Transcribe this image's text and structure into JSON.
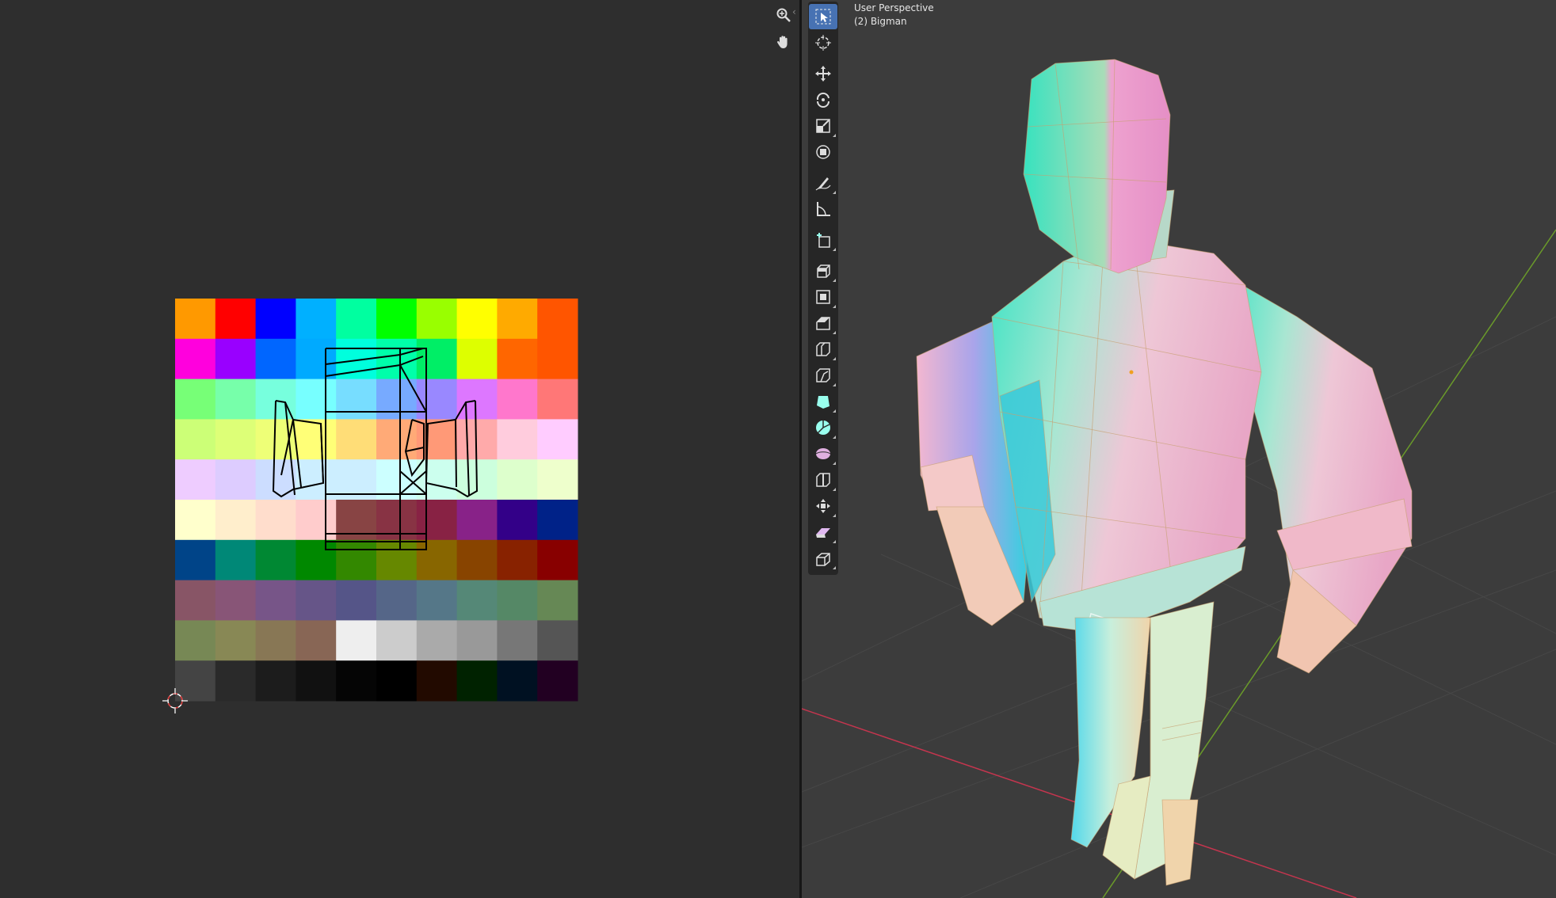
{
  "viewport": {
    "perspective_label": "User Perspective",
    "object_label": "(2) Bigman"
  },
  "uv_editor": {
    "nav_icons": [
      "zoom-icon",
      "hand-pan-icon"
    ],
    "palette_rows": [
      [
        "#ff9900",
        "#ff0000",
        "#0000ff",
        "#00b0ff",
        "#00ffa0",
        "#00ff00",
        "#99ff00",
        "#ffff00",
        "#ffaa00",
        "#ff5500"
      ],
      [
        "#ff00dd",
        "#9900ff",
        "#0066ff",
        "#00aaff",
        "#00ffdd",
        "#00ffaa",
        "#00ee66",
        "#ddff00",
        "#ff6600",
        "#ff5500"
      ],
      [
        "#77ff77",
        "#77ffaa",
        "#77ffdd",
        "#77ffff",
        "#77ddff",
        "#77aaff",
        "#9988ff",
        "#dd77ff",
        "#ff77cc",
        "#ff7777"
      ],
      [
        "#ccff77",
        "#ddff77",
        "#eeff77",
        "#ffff77",
        "#ffdd77",
        "#ffaa77",
        "#ff9977",
        "#ffaaaa",
        "#ffccdd",
        "#ffccff"
      ],
      [
        "#eeccff",
        "#ddccff",
        "#ccddff",
        "#cceeff",
        "#cceeff",
        "#ccffff",
        "#ccffee",
        "#ccffdd",
        "#ddffcc",
        "#eeffcc"
      ],
      [
        "#ffffcc",
        "#ffeecc",
        "#ffddcc",
        "#ffcccc",
        "#884444",
        "#883344",
        "#882244",
        "#882288",
        "#330088",
        "#002288"
      ],
      [
        "#004488",
        "#008877",
        "#008833",
        "#008800",
        "#338800",
        "#668800",
        "#886600",
        "#884400",
        "#882200",
        "#880000"
      ],
      [
        "#885566",
        "#885577",
        "#775588",
        "#665588",
        "#555588",
        "#556688",
        "#557788",
        "#558877",
        "#558866",
        "#668855"
      ],
      [
        "#778855",
        "#888855",
        "#887755",
        "#886655",
        "#eeeeee",
        "#cccccc",
        "#aaaaaa",
        "#999999",
        "#777777",
        "#555555"
      ],
      [
        "#444444",
        "#2a2a2a",
        "#1c1c1c",
        "#111111",
        "#050505",
        "#000000",
        "#220a00",
        "#002200",
        "#001122",
        "#220022"
      ]
    ]
  },
  "toolbar": {
    "tools": [
      "select-box-tool",
      "cursor-tool",
      "move-tool",
      "rotate-tool",
      "scale-tool",
      "transform-tool",
      "annotate-tool",
      "measure-tool",
      "add-cube-tool",
      "extrude-region-tool",
      "inset-faces-tool",
      "bevel-tool",
      "loop-cut-tool",
      "knife-tool",
      "poly-build-tool",
      "spin-tool",
      "smooth-tool",
      "edge-slide-tool",
      "shrink-fatten-tool",
      "shear-tool",
      "rip-region-tool"
    ],
    "active_tool": "select-box-tool"
  },
  "colors": {
    "accent": "#4772b3",
    "x_axis": "#c4354e",
    "y_axis": "#6a9a2a"
  }
}
